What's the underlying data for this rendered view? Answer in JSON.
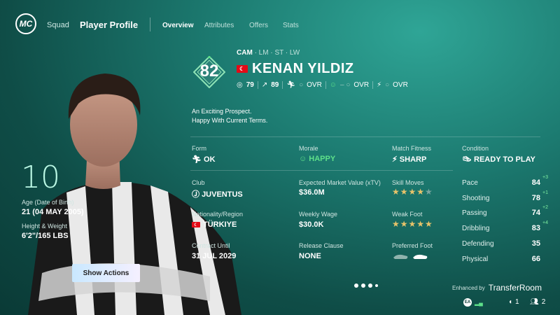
{
  "header": {
    "logo_text": "MC",
    "squad_label": "Squad",
    "page_title": "Player Profile",
    "tabs": [
      {
        "label": "Overview",
        "active": true
      },
      {
        "label": "Attributes",
        "active": false
      },
      {
        "label": "Offers",
        "active": false
      },
      {
        "label": "Stats",
        "active": false
      }
    ]
  },
  "player": {
    "rating": "82",
    "primary_position": "CAM",
    "alt_positions": "· LM · ST · LW",
    "name": "KENAN YILDIZ",
    "potential_a": "79",
    "potential_b": "89",
    "ovr_label": "OVR",
    "description_line1": "An Exciting Prospect.",
    "description_line2": "Happy With Current Terms.",
    "jersey_number": "10",
    "age_label": "Age (Date of Birth)",
    "age_value": "21 (04 MAY 2005)",
    "height_weight_label": "Height & Weight",
    "height_weight_value": "6'2\"/165 LBS"
  },
  "status": {
    "form_label": "Form",
    "form_value": "OK",
    "morale_label": "Morale",
    "morale_value": "HAPPY",
    "fitness_label": "Match Fitness",
    "fitness_value": "SHARP",
    "condition_label": "Condition",
    "condition_value": "READY TO PLAY"
  },
  "details": {
    "club_label": "Club",
    "club_value": "JUVENTUS",
    "market_label": "Expected Market Value (xTV)",
    "market_value": "$36.0M",
    "skill_label": "Skill Moves",
    "skill_stars": 4,
    "nationality_label": "Nationality/Region",
    "nationality_value": "TÜRKIYE",
    "wage_label": "Weekly Wage",
    "wage_value": "$30.0K",
    "weakfoot_label": "Weak Foot",
    "weakfoot_stars": 5,
    "contract_label": "Contract Until",
    "contract_value": "31 JUL 2029",
    "release_label": "Release Clause",
    "release_value": "NONE",
    "foot_label": "Preferred Foot"
  },
  "attributes": [
    {
      "name": "Pace",
      "value": "84",
      "delta": "+3"
    },
    {
      "name": "Shooting",
      "value": "78",
      "delta": "+1"
    },
    {
      "name": "Passing",
      "value": "74",
      "delta": "+2"
    },
    {
      "name": "Dribbling",
      "value": "83",
      "delta": "+4"
    },
    {
      "name": "Defending",
      "value": "35",
      "delta": ""
    },
    {
      "name": "Physical",
      "value": "66",
      "delta": ""
    }
  ],
  "actions": {
    "show_actions": "Show Actions"
  },
  "footer": {
    "enhanced_by": "Enhanced by",
    "brand": "TransferRoom",
    "count_a": "1",
    "count_b": "2"
  },
  "colors": {
    "accent_green": "#5ee08a",
    "star_gold": "#e8c36a"
  }
}
